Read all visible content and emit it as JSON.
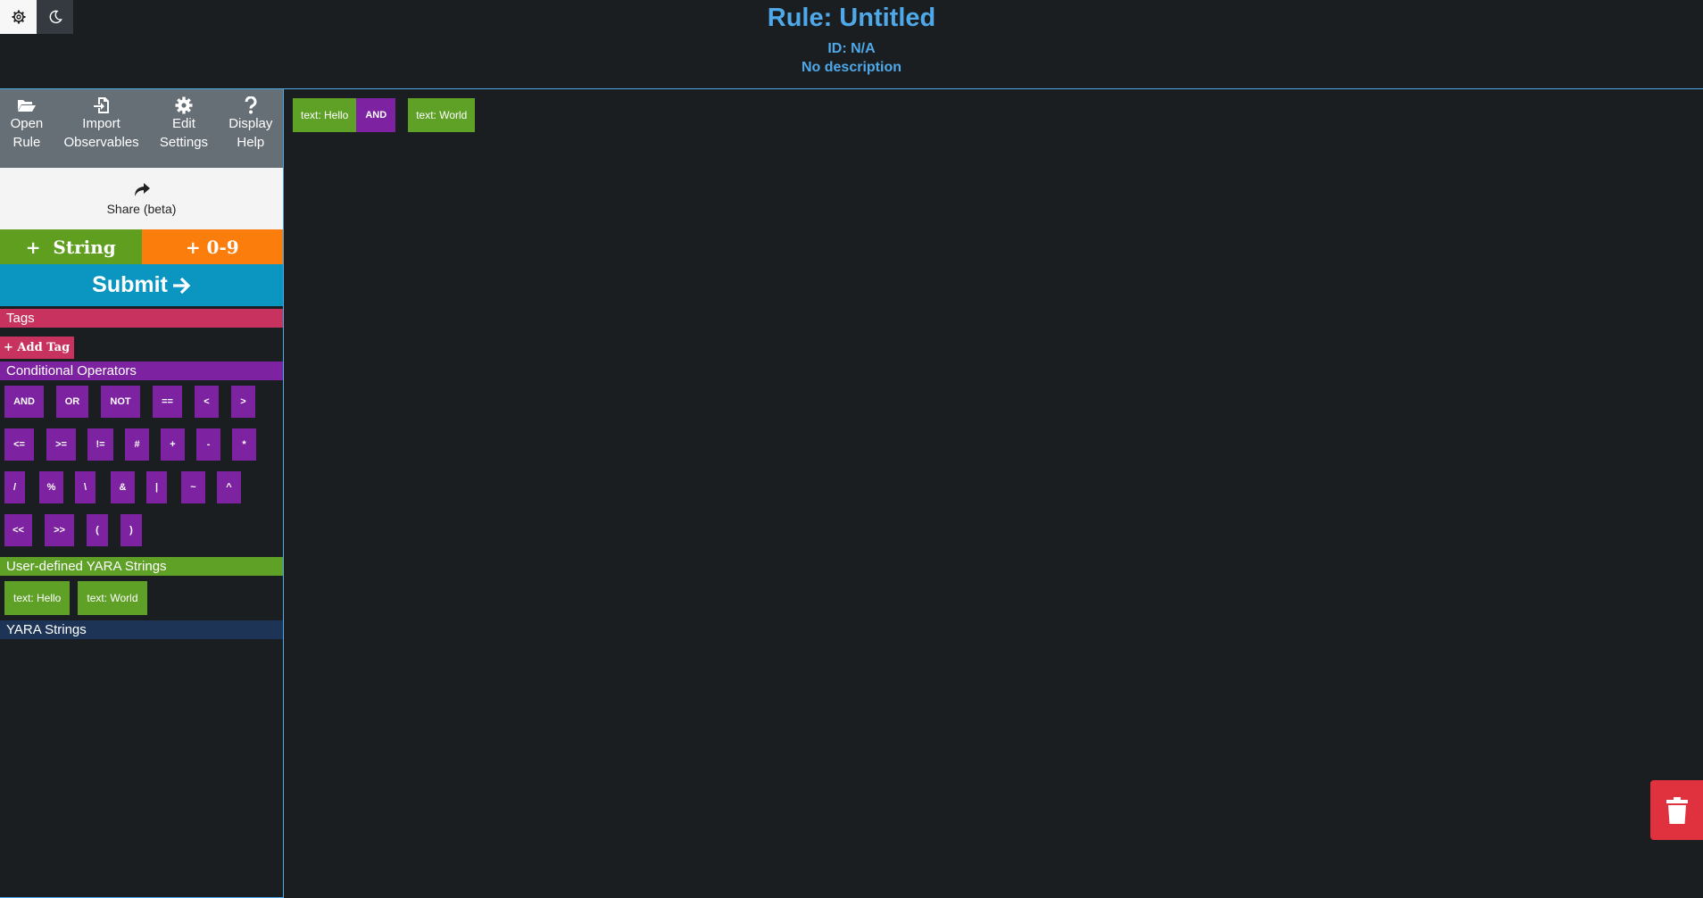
{
  "header": {
    "title": "Rule: Untitled",
    "id_line": "ID: N/A",
    "description": "No description"
  },
  "top_buttons": [
    {
      "icon": "gear-icon"
    },
    {
      "icon": "moon-icon"
    }
  ],
  "toolbar": {
    "open_rule": "Open\nRule",
    "open_rule_l1": "Open",
    "open_rule_l2": "Rule",
    "import_l1": "Import",
    "import_l2": "Observables",
    "edit_l1": "Edit",
    "edit_l2": "Settings",
    "help_l1": "Display",
    "help_l2": "Help"
  },
  "share": {
    "label": "Share (beta)"
  },
  "add": {
    "string": "+  String",
    "number": "+ 0-9"
  },
  "submit": {
    "label": "Submit"
  },
  "sections": {
    "tags": "Tags",
    "operators": "Conditional Operators",
    "user_strings": "User-defined YARA Strings",
    "yara_strings": "YARA Strings"
  },
  "tags": {
    "add_label": "+ Add Tag"
  },
  "operators": [
    [
      "AND",
      "OR",
      "NOT",
      "==",
      "<",
      ">"
    ],
    [
      "<=",
      ">=",
      "!=",
      "#",
      "+",
      "-",
      "*"
    ],
    [
      "/",
      "%",
      "\\",
      "&",
      "|",
      "~",
      "^"
    ],
    [
      "<<",
      ">>",
      "(",
      ")"
    ]
  ],
  "user_strings": [
    "text: Hello",
    "text: World"
  ],
  "workspace": [
    "text: Hello",
    "AND",
    "text: World"
  ],
  "colors": {
    "accent": "#4fa8e8",
    "string": "#5fa127",
    "operator": "#7d22a1",
    "tag": "#c8325e",
    "number": "#fb7d0b",
    "submit": "#0b96c2",
    "delete": "#e0313f"
  }
}
